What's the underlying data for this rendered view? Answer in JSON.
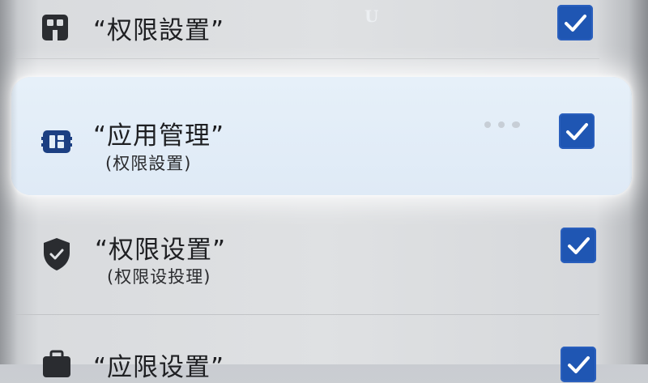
{
  "watermark": "U",
  "items": [
    {
      "title": "“权限設置”",
      "subtitle": "",
      "icon": "app-grid-icon",
      "checked": true
    },
    {
      "title": "“应用管理”",
      "subtitle": "(权限設置)",
      "icon": "app-manage-icon",
      "checked": true,
      "highlighted": true
    },
    {
      "title": "“权限设置”",
      "subtitle": "(权限设投理)",
      "icon": "shield-check-icon",
      "checked": true
    },
    {
      "title": "“应限设置”",
      "subtitle": "",
      "icon": "briefcase-icon",
      "checked": true
    }
  ],
  "colors": {
    "checkbox": "#1f56b3",
    "highlight": "#e3eef8"
  }
}
